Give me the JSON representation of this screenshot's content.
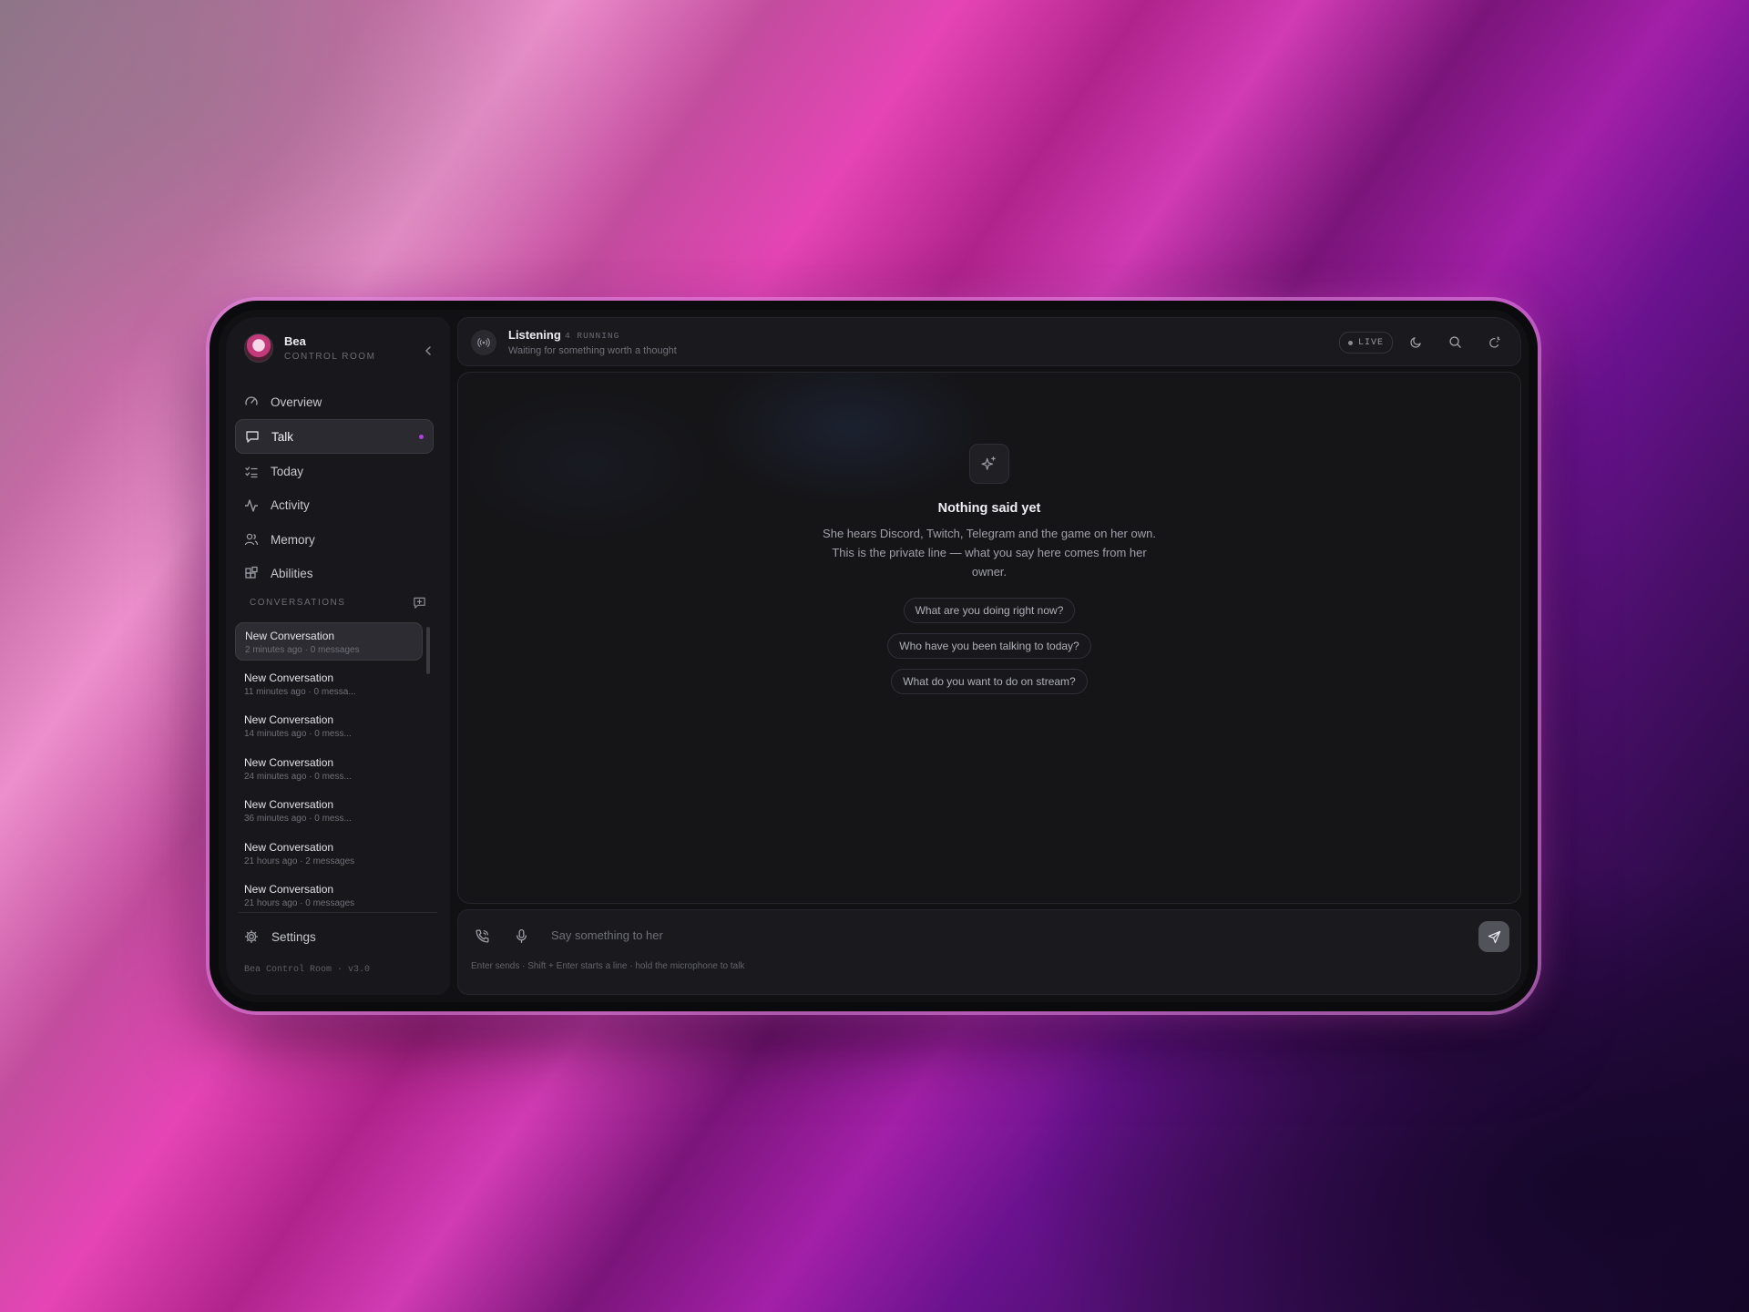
{
  "brand": {
    "name": "Bea",
    "subtitle": "CONTROL ROOM",
    "collapse_icon": "chevron-left-icon"
  },
  "nav": {
    "items": [
      {
        "label": "Overview",
        "icon": "gauge-icon"
      },
      {
        "label": "Talk",
        "icon": "message-square-icon",
        "active": true
      },
      {
        "label": "Today",
        "icon": "list-checks-icon"
      },
      {
        "label": "Activity",
        "icon": "activity-icon"
      },
      {
        "label": "Memory",
        "icon": "users-icon"
      },
      {
        "label": "Abilities",
        "icon": "blocks-icon"
      }
    ]
  },
  "conversations": {
    "heading": "CONVERSATIONS",
    "new_icon": "message-plus-icon",
    "items": [
      {
        "name": "New Conversation",
        "meta": "2 minutes ago · 0 messages",
        "active": true
      },
      {
        "name": "New Conversation",
        "meta": "11 minutes ago · 0 messa..."
      },
      {
        "name": "New Conversation",
        "meta": "14 minutes ago · 0 mess..."
      },
      {
        "name": "New Conversation",
        "meta": "24 minutes ago · 0 mess..."
      },
      {
        "name": "New Conversation",
        "meta": "36 minutes ago · 0 mess..."
      },
      {
        "name": "New Conversation",
        "meta": "21 hours ago · 2 messages"
      },
      {
        "name": "New Conversation",
        "meta": "21 hours ago · 0 messages"
      }
    ]
  },
  "settings": {
    "label": "Settings",
    "icon": "gear-icon"
  },
  "version": "Bea Control Room · v3.0",
  "status": {
    "title": "Listening",
    "running": "4 RUNNING",
    "subtitle": "Waiting for something worth a thought",
    "icon": "broadcast-icon"
  },
  "topbar": {
    "live_label": "LIVE",
    "icons": [
      "moon-icon",
      "search-icon",
      "theme-icon"
    ]
  },
  "empty": {
    "title": "Nothing said yet",
    "description": "She hears Discord, Twitch, Telegram and the game on her own. This is the private line — what you say here comes from her owner.",
    "suggestions": [
      "What are you doing right now?",
      "Who have you been talking to today?",
      "What do you want to do on stream?"
    ]
  },
  "composer": {
    "placeholder": "Say something to her",
    "value": "",
    "hint": "Enter sends · Shift + Enter starts a line · hold the microphone to talk"
  },
  "colors": {
    "accent": "#b040e0",
    "background": "#111114",
    "sidebar": "#18181c"
  }
}
